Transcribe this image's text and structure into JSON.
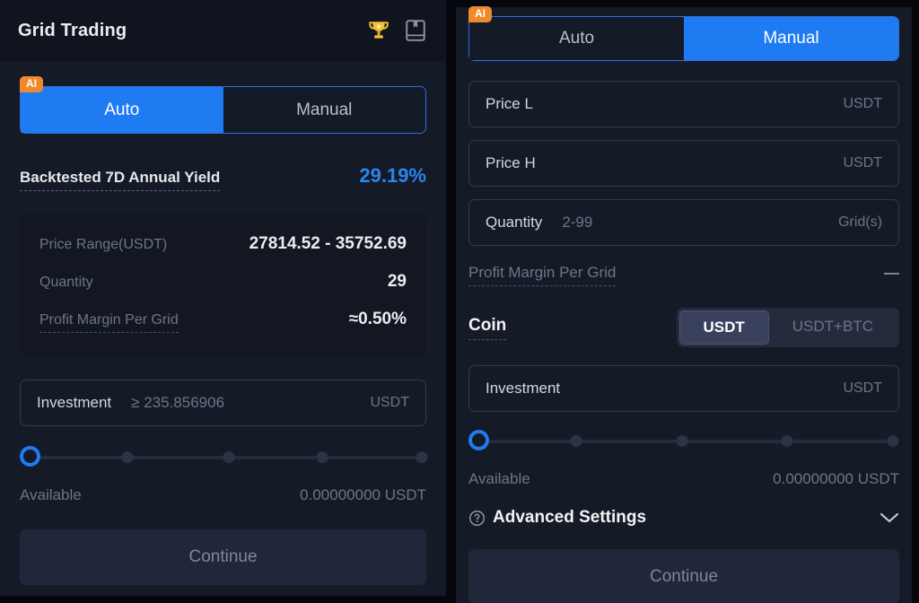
{
  "left_panel": {
    "header": {
      "title": "Grid Trading",
      "icons": [
        {
          "name": "trophy-icon",
          "color": "#f5c033"
        },
        {
          "name": "manual-book-icon",
          "color": "#8b92a5"
        }
      ]
    },
    "mode_tabs": {
      "badge": "AI",
      "items": [
        {
          "label": "Auto",
          "active": true
        },
        {
          "label": "Manual",
          "active": false
        }
      ],
      "active_color": "#1f7bf2",
      "badge_color": "#f0892c"
    },
    "yield": {
      "label": "Backtested 7D Annual Yield",
      "value": "29.19%",
      "value_color": "#2a85f0"
    },
    "info_card": {
      "rows": [
        {
          "key": "Price Range(USDT)",
          "value": "27814.52 - 35752.69",
          "dashed": false
        },
        {
          "key": "Quantity",
          "value": "29",
          "dashed": false
        },
        {
          "key": "Profit Margin Per Grid",
          "value": "≈0.50%",
          "dashed": true
        }
      ]
    },
    "investment": {
      "label": "Investment",
      "placeholder": "≥ 235.856906",
      "suffix": "USDT"
    },
    "slider": {
      "value": 0,
      "ticks": [
        25,
        50,
        75,
        100
      ]
    },
    "available": {
      "label": "Available",
      "value": "0.00000000 USDT"
    },
    "continue": "Continue"
  },
  "right_panel": {
    "mode_tabs": {
      "badge": "AI",
      "items": [
        {
          "label": "Auto",
          "active": false
        },
        {
          "label": "Manual",
          "active": true
        }
      ]
    },
    "fields": [
      {
        "label": "Price L",
        "placeholder": "",
        "suffix": "USDT"
      },
      {
        "label": "Price H",
        "placeholder": "",
        "suffix": "USDT"
      },
      {
        "label": "Quantity",
        "placeholder": "2-99",
        "suffix": "Grid(s)"
      }
    ],
    "profit_margin": {
      "label": "Profit Margin Per Grid",
      "value": "—"
    },
    "coin": {
      "label": "Coin",
      "options": [
        {
          "label": "USDT",
          "active": true
        },
        {
          "label": "USDT+BTC",
          "active": false
        }
      ]
    },
    "investment": {
      "label": "Investment",
      "placeholder": "",
      "suffix": "USDT"
    },
    "slider": {
      "value": 0,
      "ticks": [
        25,
        50,
        75,
        100
      ]
    },
    "available": {
      "label": "Available",
      "value": "0.00000000 USDT"
    },
    "advanced": {
      "label": "Advanced Settings",
      "expanded": false
    },
    "continue": "Continue"
  }
}
